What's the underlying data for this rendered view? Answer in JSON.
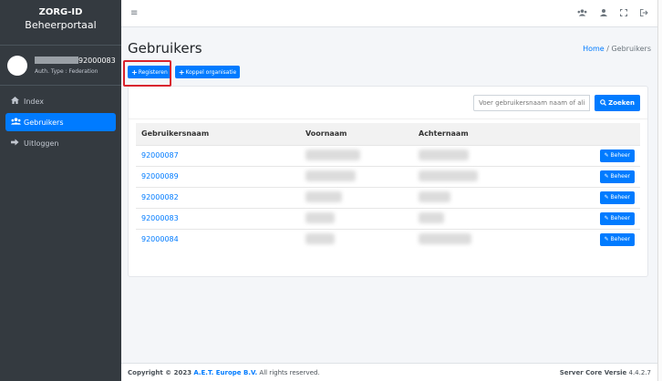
{
  "sidebar": {
    "brand_title": "ZORG-ID",
    "brand_sub": "Beheerportaal",
    "user_id": "92000083",
    "auth_type": "Auth. Type : Federation",
    "items": [
      {
        "label": "Index",
        "icon": "home-icon"
      },
      {
        "label": "Gebruikers",
        "icon": "users-icon"
      },
      {
        "label": "Uitloggen",
        "icon": "sign-out-icon"
      }
    ]
  },
  "topbar": {
    "hamburger": "≡",
    "icons": [
      "users-icon",
      "user-icon",
      "fullscreen-icon",
      "logout-icon"
    ]
  },
  "header": {
    "title": "Gebruikers",
    "breadcrumb_home": "Home",
    "breadcrumb_sep": "/",
    "breadcrumb_current": "Gebruikers"
  },
  "actions": {
    "register_label": "Registeren",
    "koppel_label": "Koppel organisatie"
  },
  "search": {
    "placeholder": "Voer gebruikersnaam naam of alias in",
    "button_label": "Zoeken"
  },
  "table": {
    "headers": [
      "Gebruikersnaam",
      "Voornaam",
      "Achternaam",
      ""
    ],
    "rows": [
      {
        "username": "92000087",
        "action": "Beheer"
      },
      {
        "username": "92000089",
        "action": "Beheer"
      },
      {
        "username": "92000082",
        "action": "Beheer"
      },
      {
        "username": "92000083",
        "action": "Beheer"
      },
      {
        "username": "92000084",
        "action": "Beheer"
      }
    ]
  },
  "footer": {
    "copyright_prefix": "Copyright © 2023",
    "company": "A.E.T. Europe B.V.",
    "rights": "All rights reserved.",
    "version_label": "Server Core Versie",
    "version": "4.4.2.7"
  },
  "colors": {
    "primary": "#007bff",
    "sidebar_bg": "#343a40",
    "highlight": "#d9232e"
  }
}
